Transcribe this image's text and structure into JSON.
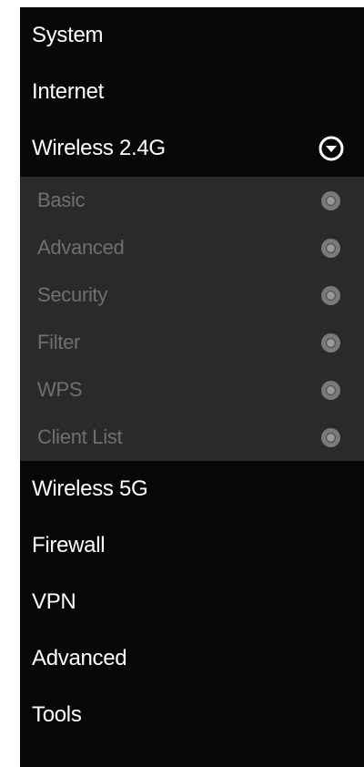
{
  "menu": {
    "top_items": [
      {
        "label": "System"
      },
      {
        "label": "Internet"
      }
    ],
    "expanded_item": {
      "label": "Wireless 2.4G",
      "icon": "chevron-down-circle-icon"
    },
    "sub_items": [
      {
        "label": "Basic",
        "icon": "circle-bullet-icon"
      },
      {
        "label": "Advanced",
        "icon": "circle-bullet-icon"
      },
      {
        "label": "Security",
        "icon": "circle-bullet-icon"
      },
      {
        "label": "Filter",
        "icon": "circle-bullet-icon"
      },
      {
        "label": "WPS",
        "icon": "circle-bullet-icon"
      },
      {
        "label": "Client List",
        "icon": "circle-bullet-icon"
      }
    ],
    "bottom_items": [
      {
        "label": "Wireless 5G"
      },
      {
        "label": "Firewall"
      },
      {
        "label": "VPN"
      },
      {
        "label": "Advanced"
      },
      {
        "label": "Tools"
      }
    ]
  },
  "colors": {
    "background": "#070707",
    "submenu_background": "#2a2a2a",
    "text": "#ffffff",
    "sub_text": "#6f6f6f"
  }
}
